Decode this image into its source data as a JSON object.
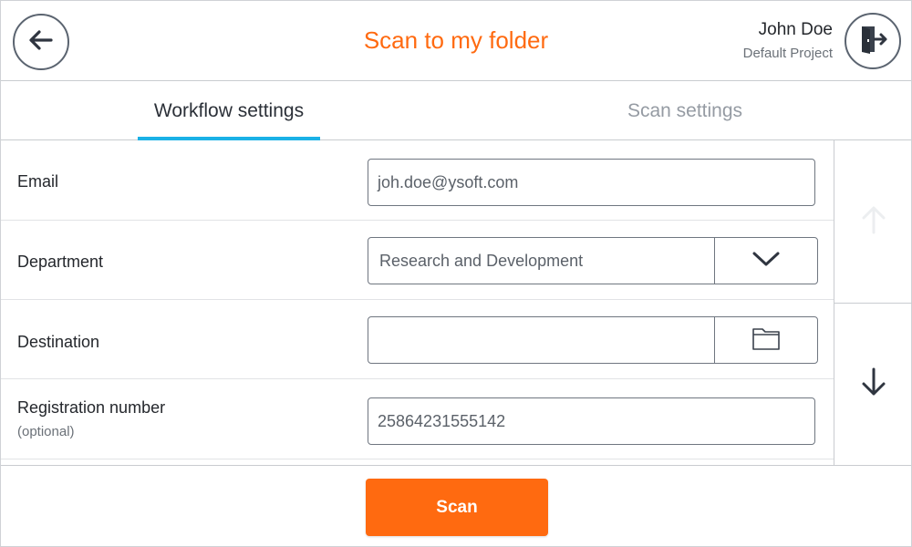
{
  "header": {
    "title": "Scan to my folder",
    "user_name": "John Doe",
    "project": "Default Project",
    "back_icon": "arrow-left-icon",
    "logout_icon": "logout-door-icon"
  },
  "tabs": [
    {
      "label": "Workflow settings",
      "active": true
    },
    {
      "label": "Scan settings",
      "active": false
    }
  ],
  "form": {
    "email": {
      "label": "Email",
      "value": "joh.doe@ysoft.com"
    },
    "department": {
      "label": "Department",
      "value": "Research and Development",
      "icon": "chevron-down-icon"
    },
    "destination": {
      "label": "Destination",
      "value": "",
      "icon": "folder-icon"
    },
    "registration": {
      "label": "Registration number",
      "sublabel": "(optional)",
      "value": "25864231555142"
    }
  },
  "scroll": {
    "up_icon": "arrow-up-icon",
    "down_icon": "arrow-down-icon",
    "up_enabled": false,
    "down_enabled": true
  },
  "footer": {
    "scan_label": "Scan"
  },
  "colors": {
    "accent": "#ff6a10",
    "tab_indicator": "#1ab1e6",
    "border": "#c9ccd0"
  }
}
